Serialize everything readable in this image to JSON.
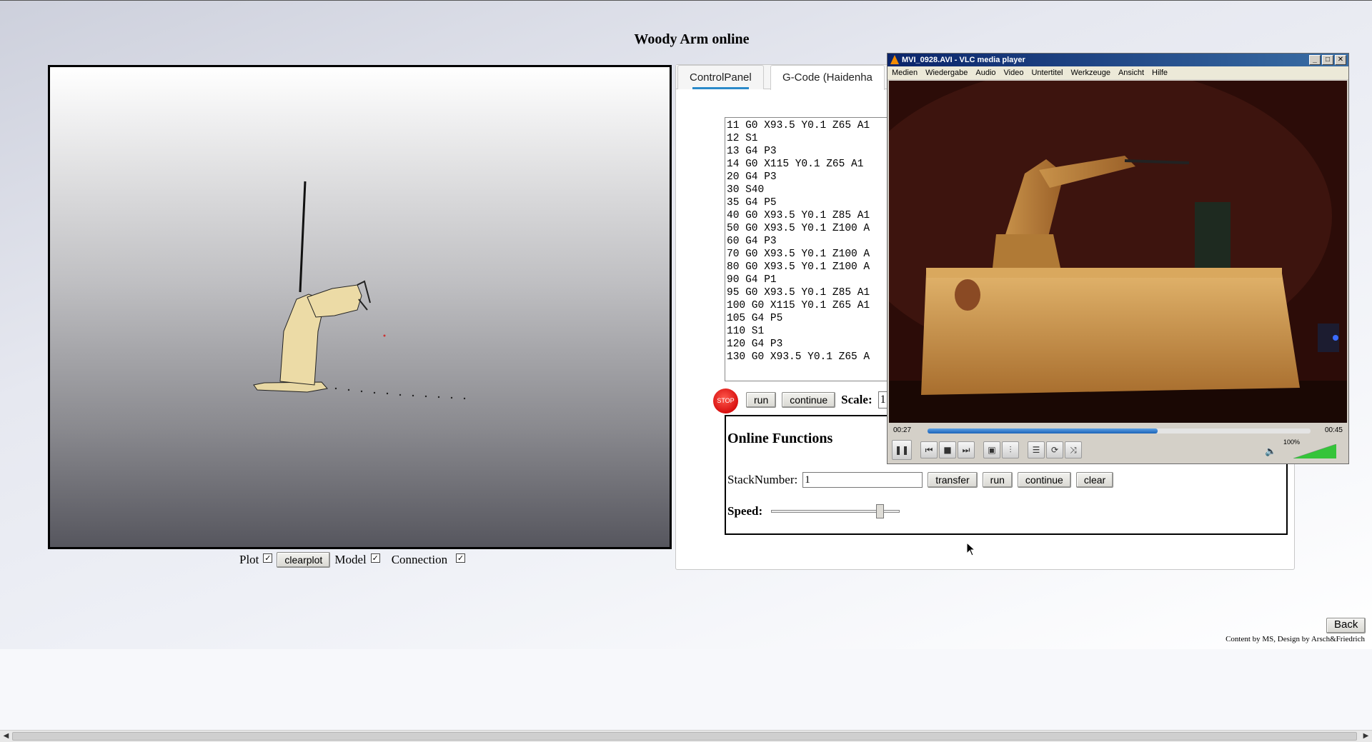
{
  "page": {
    "title": "Woody Arm online"
  },
  "view_controls": {
    "plot_label": "Plot",
    "plot_checked": true,
    "clearplot_label": "clearplot",
    "model_label": "Model",
    "model_checked": true,
    "connection_label": "Connection",
    "connection_checked": true,
    "check_glyph": "✓"
  },
  "tabs": [
    {
      "label": "ControlPanel"
    },
    {
      "label": "G-Code (Haidenha"
    }
  ],
  "gcode": {
    "lines": [
      "11 G0 X93.5 Y0.1 Z65 A1",
      "12 S1",
      "13 G4 P3",
      "14 G0 X115 Y0.1 Z65 A1",
      "20 G4 P3",
      "30 S40",
      "35 G4 P5",
      "40 G0 X93.5 Y0.1 Z85 A1",
      "50 G0 X93.5 Y0.1 Z100 A",
      "60 G4 P3",
      "70 G0 X93.5 Y0.1 Z100 A",
      "80 G0 X93.5 Y0.1 Z100 A",
      "90 G4 P1",
      "95 G0 X93.5 Y0.1 Z85 A1",
      "100 G0 X115 Y0.1 Z65 A1",
      "105 G4 P5",
      "110 S1",
      "120 G4 P3",
      "130 G0 X93.5 Y0.1 Z65 A"
    ],
    "stop_label": "STOP",
    "run_label": "run",
    "continue_label": "continue",
    "scale_label": "Scale:",
    "scale_value": "1"
  },
  "online": {
    "title": "Online Functions",
    "stack_label": "StackNumber:",
    "stack_value": "1",
    "transfer_label": "transfer",
    "run_label": "run",
    "continue_label": "continue",
    "clear_label": "clear",
    "speed_label": "Speed:",
    "speed_level": 0.85
  },
  "vlc": {
    "title": "MVI_0928.AVI - VLC media player",
    "menu": [
      "Medien",
      "Wiedergabe",
      "Audio",
      "Video",
      "Untertitel",
      "Werkzeuge",
      "Ansicht",
      "Hilfe"
    ],
    "time_elapsed": "00:27",
    "time_total": "00:45",
    "progress": 0.6,
    "volume_label": "100%",
    "volume_level": 1.0,
    "brand_color": "#f28b00"
  },
  "footer": {
    "back_label": "Back",
    "credits": "Content by MS, Design by Arsch&Friedrich"
  }
}
